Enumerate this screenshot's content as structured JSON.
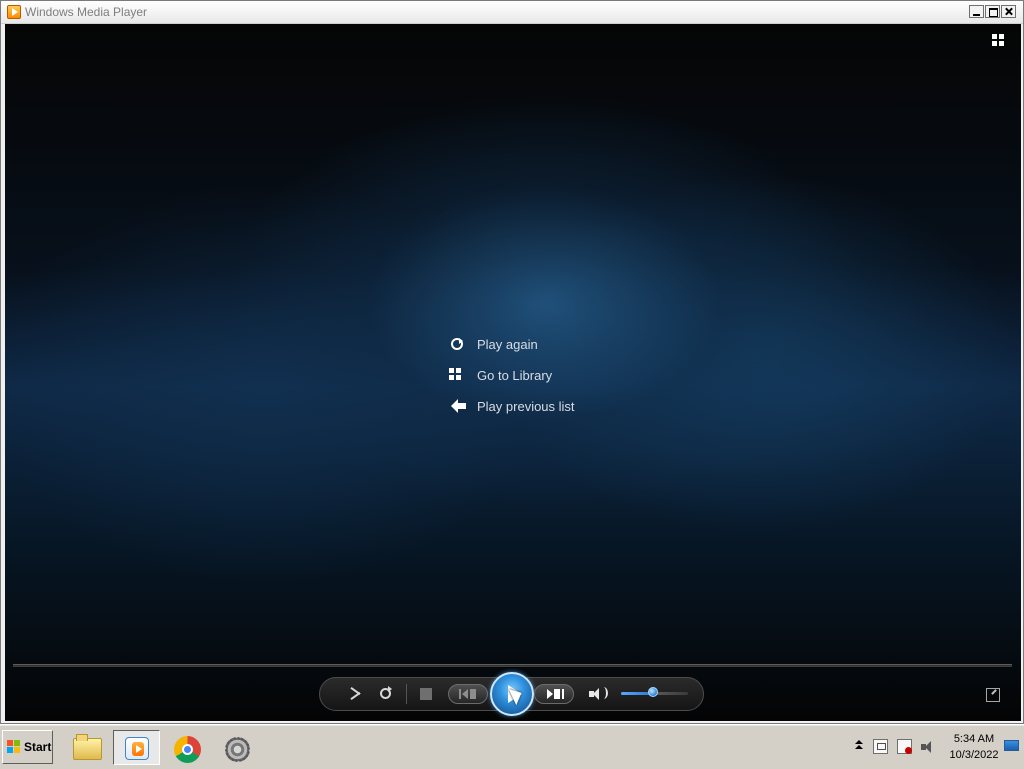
{
  "window": {
    "title": "Windows Media Player",
    "controls": {
      "minimize": "minimize-icon",
      "maximize": "maximize-icon",
      "close": "close-icon"
    }
  },
  "player": {
    "top_right_icon": "switch-to-library-icon",
    "menu": [
      {
        "label": "Play again",
        "icon": "replay-icon"
      },
      {
        "label": "Go to Library",
        "icon": "library-icon"
      },
      {
        "label": "Play previous list",
        "icon": "back-arrow-icon"
      }
    ],
    "controls": [
      "shuffle-icon",
      "repeat-icon",
      "stop-icon",
      "previous-icon",
      "play-icon",
      "next-icon",
      "mute-icon",
      "volume-slider-icon",
      "fullscreen-toggle-icon"
    ],
    "volume_level": 0.5
  },
  "taskbar": {
    "start_label": "Start",
    "apps": [
      {
        "name": "file-explorer-icon",
        "active": false
      },
      {
        "name": "windows-media-player-icon",
        "active": true
      },
      {
        "name": "chrome-icon",
        "active": false
      },
      {
        "name": "settings-icon",
        "active": false
      }
    ],
    "tray": {
      "time": "5:34 AM",
      "date": "10/3/2022"
    }
  },
  "colors": {
    "video_background": "#0f2947",
    "accent": "#2f8fdc"
  }
}
